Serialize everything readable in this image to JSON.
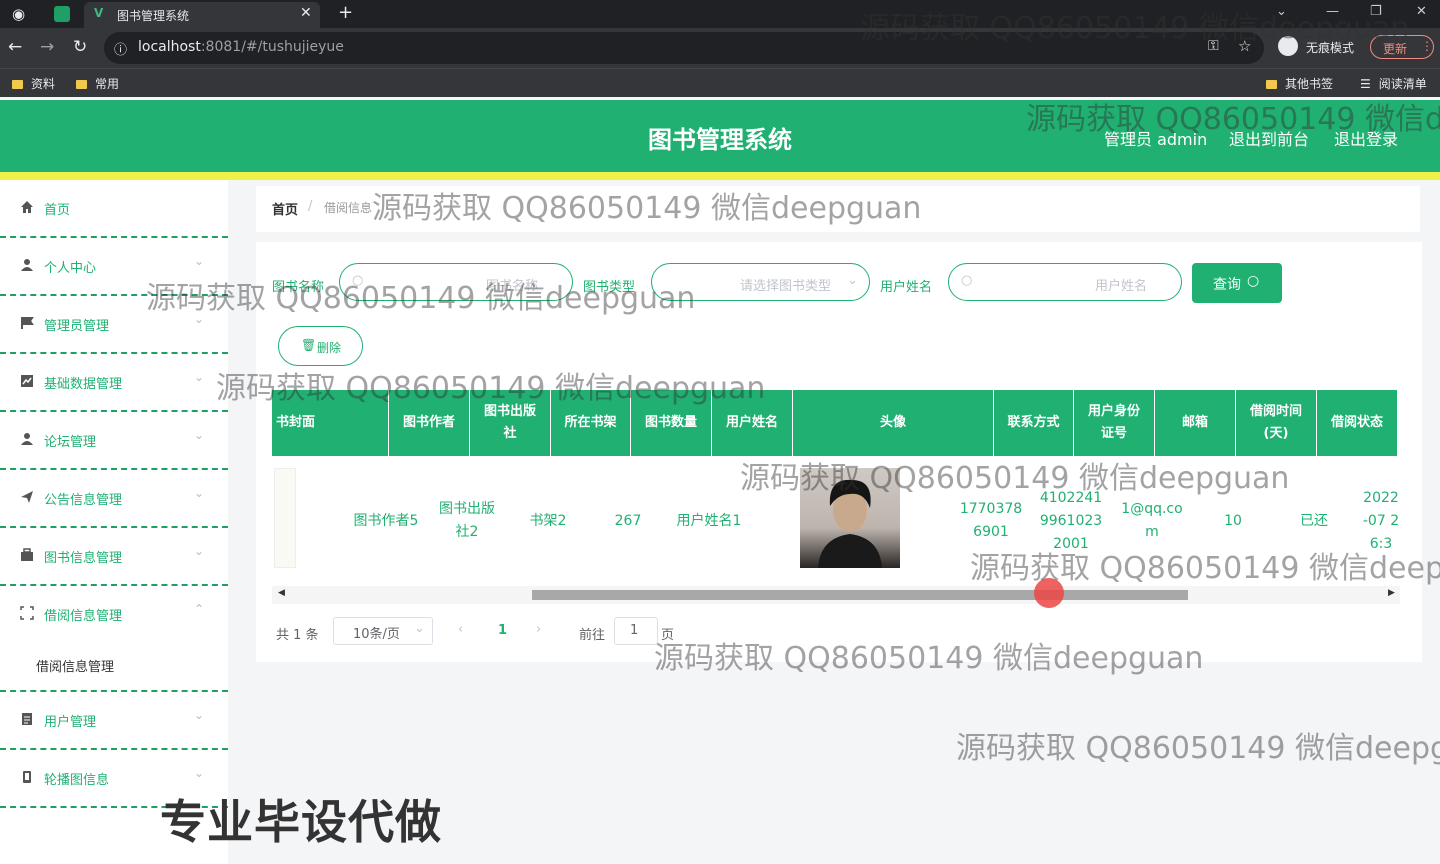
{
  "browser": {
    "tab_title": "图书管理系统",
    "url_host": "localhost",
    "url_rest": ":8081/#/tushujieyue",
    "incognito": "无痕模式",
    "update": "更新",
    "bookmarks": [
      "资料",
      "常用"
    ],
    "bookmarks_right": [
      "其他书签",
      "阅读清单"
    ]
  },
  "header": {
    "title": "图书管理系统",
    "admin": "管理员 admin",
    "front": "退出到前台",
    "logout": "退出登录"
  },
  "sidebar": {
    "items": [
      {
        "label": "首页",
        "icon": "home-icon"
      },
      {
        "label": "个人中心",
        "icon": "user-icon"
      },
      {
        "label": "管理员管理",
        "icon": "flag-icon"
      },
      {
        "label": "基础数据管理",
        "icon": "chart-icon"
      },
      {
        "label": "论坛管理",
        "icon": "user-icon"
      },
      {
        "label": "公告信息管理",
        "icon": "send-icon"
      },
      {
        "label": "图书信息管理",
        "icon": "briefcase-icon"
      },
      {
        "label": "借阅信息管理",
        "icon": "expand-icon"
      },
      {
        "label": "用户管理",
        "icon": "document-icon"
      },
      {
        "label": "轮播图信息",
        "icon": "phone-icon"
      }
    ],
    "sub_item": "借阅信息管理"
  },
  "breadcrumb": {
    "home": "首页",
    "sep": "/",
    "current": "借阅信息"
  },
  "search": {
    "book_name_label": "图书名称",
    "book_name_placeholder": "图书名称",
    "book_type_label": "图书类型",
    "book_type_placeholder": "请选择图书类型",
    "user_name_label": "用户姓名",
    "user_name_placeholder": "用户姓名",
    "query_button": "查询"
  },
  "actions": {
    "delete": "删除"
  },
  "table": {
    "headers": [
      "书封面",
      "图书作者",
      "图书出版社",
      "所在书架",
      "图书数量",
      "用户姓名",
      "头像",
      "联系方式",
      "用户身份证号",
      "邮箱",
      "借阅时间(天)",
      "借阅状态"
    ],
    "row": {
      "author": "图书作者5",
      "publisher": "图书出版社2",
      "shelf": "书架2",
      "count": "267",
      "user": "用户姓名1",
      "phone": "17703786901",
      "idcard": "410224199610232001",
      "email": "1@qq.com",
      "days": "10",
      "status": "已还",
      "time": "2022-07 26:3"
    }
  },
  "pagination": {
    "total": "共 1 条",
    "size": "10条/页",
    "current": "1",
    "goto": "前往",
    "goto_value": "1",
    "page": "页"
  },
  "watermarks": {
    "text": "源码获取 QQ86050149 微信deepguan",
    "big": "专业毕设代做"
  }
}
